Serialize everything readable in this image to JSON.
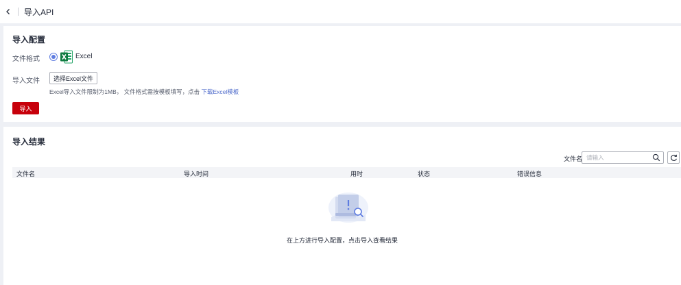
{
  "header": {
    "title": "导入API",
    "back_icon": "chevron-left-icon"
  },
  "config": {
    "title": "导入配置",
    "format_label": "文件格式",
    "format_option": "Excel",
    "format_selected": true,
    "file_label": "导入文件",
    "choose_button": "选择Excel文件",
    "hint_text": "Excel导入文件限制为1MB， 文件格式需按模板填写，点击 ",
    "hint_link": "下载Excel模板",
    "import_button": "导入"
  },
  "result": {
    "title": "导入结果",
    "filter_label": "文件名",
    "search_placeholder": "请输入",
    "search_value": "",
    "columns": [
      "文件名",
      "导入时间",
      "用时",
      "状态",
      "错误信息"
    ],
    "rows": [],
    "empty_text": "在上方进行导入配置，点击导入查看结果"
  },
  "colors": {
    "primary": "#5e7ce0",
    "danger_button": "#c7000b",
    "link": "#526ecc",
    "excel_green": "#21a366",
    "page_bg": "#eef0f5"
  }
}
